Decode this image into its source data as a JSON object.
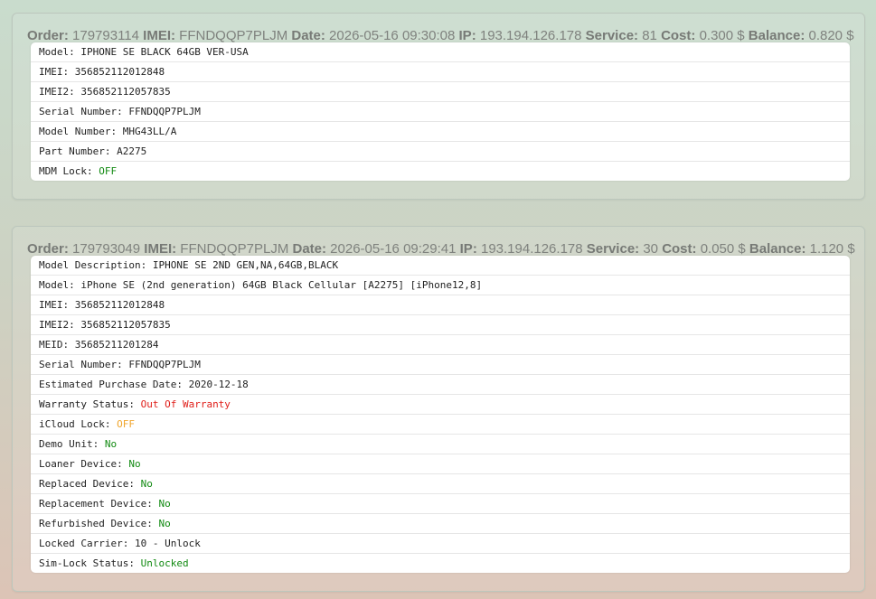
{
  "orders": [
    {
      "header": {
        "order_label": "Order:",
        "order": "179793114",
        "imei_label": "IMEI:",
        "imei": "FFNDQQP7PLJM",
        "date_label": "Date:",
        "date": "2026-05-16 09:30:08",
        "ip_label": "IP:",
        "ip": "193.194.126.178",
        "service_label": "Service:",
        "service": "81",
        "cost_label": "Cost:",
        "cost": "0.300 $",
        "balance_label": "Balance:",
        "balance": "0.820 $"
      },
      "rows": [
        {
          "label": "Model: ",
          "value": "IPHONE SE BLACK 64GB VER-USA"
        },
        {
          "label": "IMEI: ",
          "value": "356852112012848"
        },
        {
          "label": "IMEI2: ",
          "value": "356852112057835"
        },
        {
          "label": "Serial Number: ",
          "value": "FFNDQQP7PLJM"
        },
        {
          "label": "Model Number: ",
          "value": "MHG43LL/A"
        },
        {
          "label": "Part Number: ",
          "value": "A2275"
        },
        {
          "label": "MDM Lock: ",
          "value": "OFF",
          "color": "#128a12"
        }
      ]
    },
    {
      "header": {
        "order_label": "Order:",
        "order": "179793049",
        "imei_label": "IMEI:",
        "imei": "FFNDQQP7PLJM",
        "date_label": "Date:",
        "date": "2026-05-16 09:29:41",
        "ip_label": "IP:",
        "ip": "193.194.126.178",
        "service_label": "Service:",
        "service": "30",
        "cost_label": "Cost:",
        "cost": "0.050 $",
        "balance_label": "Balance:",
        "balance": "1.120 $"
      },
      "rows": [
        {
          "label": "Model Description: ",
          "value": "IPHONE SE 2ND GEN,NA,64GB,BLACK"
        },
        {
          "label": "Model: ",
          "value": "iPhone SE (2nd generation) 64GB Black Cellular [A2275] [iPhone12,8]"
        },
        {
          "label": "IMEI: ",
          "value": "356852112012848"
        },
        {
          "label": "IMEI2: ",
          "value": "356852112057835"
        },
        {
          "label": "MEID: ",
          "value": "35685211201284"
        },
        {
          "label": "Serial Number: ",
          "value": "FFNDQQP7PLJM"
        },
        {
          "label": "Estimated Purchase Date: ",
          "value": "2020-12-18"
        },
        {
          "label": "Warranty Status: ",
          "value": "Out Of Warranty",
          "color": "#e0201b"
        },
        {
          "label": "iCloud Lock: ",
          "value": "OFF",
          "color": "#f0a52c"
        },
        {
          "label": "Demo Unit: ",
          "value": "No",
          "color": "#128a12"
        },
        {
          "label": "Loaner Device: ",
          "value": "No",
          "color": "#128a12"
        },
        {
          "label": "Replaced Device: ",
          "value": "No",
          "color": "#128a12"
        },
        {
          "label": "Replacement Device: ",
          "value": "No",
          "color": "#128a12"
        },
        {
          "label": "Refurbished Device: ",
          "value": "No",
          "color": "#128a12"
        },
        {
          "label": "Locked Carrier: ",
          "value": "10 - Unlock"
        },
        {
          "label": "Sim-Lock Status: ",
          "value": "Unlocked",
          "color": "#128a12"
        }
      ]
    }
  ]
}
